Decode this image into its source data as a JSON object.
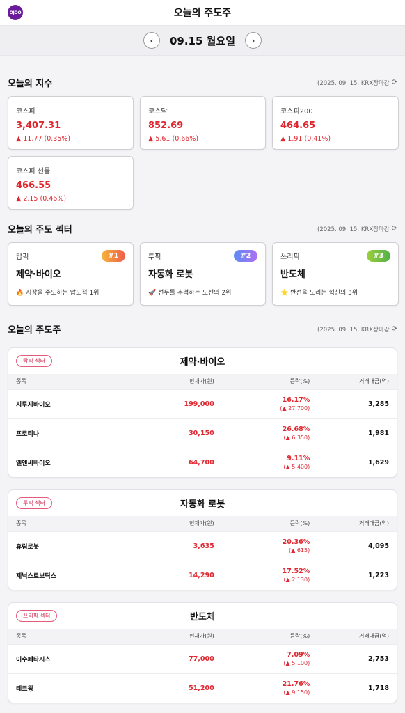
{
  "header": {
    "logo_text": "OJOO",
    "title": "오늘의 주도주"
  },
  "datebar": {
    "date": "09.15 월요일",
    "prev": "‹",
    "next": "›"
  },
  "indices": {
    "title": "오늘의 지수",
    "meta": "(2025. 09. 15. KRX장마감",
    "items": [
      {
        "name": "코스피",
        "value": "3,407.31",
        "change": "▲ 11.77 (0.35%)"
      },
      {
        "name": "코스닥",
        "value": "852.69",
        "change": "▲ 5.61 (0.66%)"
      },
      {
        "name": "코스피200",
        "value": "464.65",
        "change": "▲ 1.91 (0.41%)"
      },
      {
        "name": "코스피 선물",
        "value": "466.55",
        "change": "▲ 2.15 (0.46%)"
      }
    ]
  },
  "sectors": {
    "title": "오늘의 주도 섹터",
    "meta": "(2025. 09. 15. KRX장마감",
    "items": [
      {
        "tag": "탑픽",
        "rank": "#1",
        "name": "제약·바이오",
        "desc": "🔥 시장을 주도하는 압도적 1위",
        "color": "#f28a3a"
      },
      {
        "tag": "투픽",
        "rank": "#2",
        "name": "자동화 로봇",
        "desc": "🚀 선두를 추격하는 도전의 2위",
        "color": "#8a6cf0"
      },
      {
        "tag": "쓰리픽",
        "rank": "#3",
        "name": "반도체",
        "desc": "⭐ 반전을 노리는 혁신의 3위",
        "color": "#7cc23f"
      }
    ]
  },
  "leaders": {
    "title": "오늘의 주도주",
    "meta": "(2025. 09. 15. KRX장마감",
    "columns": {
      "name": "종목",
      "price": "현재가(원)",
      "rate": "등락(%)",
      "volume": "거래대금(억)"
    },
    "groups": [
      {
        "chip": "탑픽 섹터",
        "title": "제약·바이오",
        "rows": [
          {
            "name": "지투지바이오",
            "price": "199,000",
            "pct": "16.17%",
            "amt": "(▲ 27,700)",
            "volume": "3,285"
          },
          {
            "name": "프로티나",
            "price": "30,150",
            "pct": "26.68%",
            "amt": "(▲ 6,350)",
            "volume": "1,981"
          },
          {
            "name": "엘앤씨바이오",
            "price": "64,700",
            "pct": "9.11%",
            "amt": "(▲ 5,400)",
            "volume": "1,629"
          }
        ]
      },
      {
        "chip": "투픽 섹터",
        "title": "자동화 로봇",
        "rows": [
          {
            "name": "휴림로봇",
            "price": "3,635",
            "pct": "20.36%",
            "amt": "(▲ 615)",
            "volume": "4,095"
          },
          {
            "name": "제닉스로보틱스",
            "price": "14,290",
            "pct": "17.52%",
            "amt": "(▲ 2,130)",
            "volume": "1,223"
          }
        ]
      },
      {
        "chip": "쓰리픽 섹터",
        "title": "반도체",
        "rows": [
          {
            "name": "이수페타시스",
            "price": "77,000",
            "pct": "7.09%",
            "amt": "(▲ 5,100)",
            "volume": "2,753"
          },
          {
            "name": "테크윙",
            "price": "51,200",
            "pct": "21.76%",
            "amt": "(▲ 9,150)",
            "volume": "1,718"
          }
        ]
      }
    ]
  }
}
